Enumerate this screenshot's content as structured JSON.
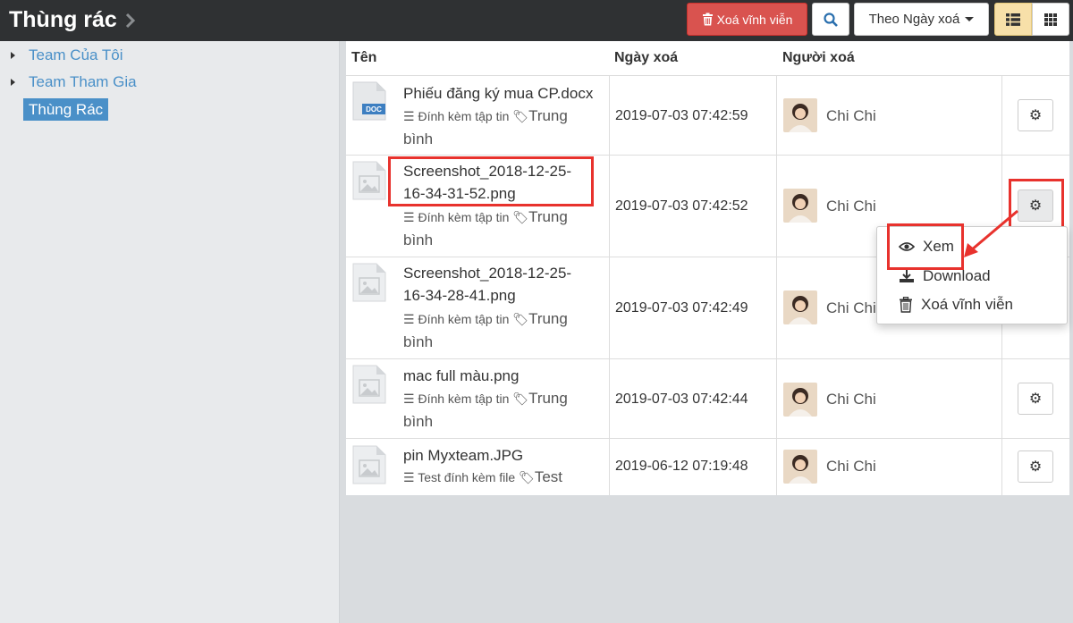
{
  "header": {
    "title": "Thùng rác",
    "delete_all_label": "Xoá vĩnh viễn",
    "sort_label": "Theo Ngày xoá"
  },
  "sidebar": {
    "items": [
      {
        "label": "Team Của Tôi"
      },
      {
        "label": "Team Tham Gia"
      },
      {
        "label": "Thùng Rác"
      }
    ]
  },
  "table": {
    "columns": [
      "Tên",
      "Ngày xoá",
      "Người xoá"
    ],
    "rows": [
      {
        "name": "Phiếu đăng ký mua CP.docx",
        "name2": "",
        "attachment": "Đính kèm tập tin",
        "tag": "Trung",
        "tag2": "bình",
        "date": "2019-07-03 07:42:59",
        "user": "Chi Chi",
        "icon": "doc-file-icon",
        "icon_text": "DOC"
      },
      {
        "name": "Screenshot_2018-12-25-",
        "name2": "16-34-31-52.png",
        "attachment": "Đính kèm tập tin",
        "tag": "Trung",
        "tag2": "bình",
        "date": "2019-07-03 07:42:52",
        "user": "Chi Chi",
        "icon": "image-file-icon"
      },
      {
        "name": "Screenshot_2018-12-25-",
        "name2": "16-34-28-41.png",
        "attachment": "Đính kèm tập tin",
        "tag": "Trung",
        "tag2": "bình",
        "date": "2019-07-03 07:42:49",
        "user": "Chi Chi",
        "icon": "image-file-icon"
      },
      {
        "name": "mac full màu.png",
        "name2": "",
        "attachment": "Đính kèm tập tin",
        "tag": "Trung",
        "tag2": "bình",
        "date": "2019-07-03 07:42:44",
        "user": "Chi Chi",
        "icon": "image-file-icon"
      },
      {
        "name": "pin Myxteam.JPG",
        "name2": "",
        "attachment": "Test đính kèm file",
        "tag": "Test",
        "tag2": "",
        "date": "2019-06-12 07:19:48",
        "user": "Chi Chi",
        "icon": "image-file-icon"
      }
    ]
  },
  "dropdown": {
    "items": [
      {
        "label": "Xem",
        "icon": "eye-icon"
      },
      {
        "label": "Download",
        "icon": "download-icon"
      },
      {
        "label": "Xoá vĩnh viễn",
        "icon": "trash-icon"
      }
    ]
  },
  "colors": {
    "topbar": "#2f3133",
    "danger": "#d9534f",
    "link": "#4a90c8",
    "highlight": "#e8322d",
    "list_view_active": "#f7e0a9"
  }
}
